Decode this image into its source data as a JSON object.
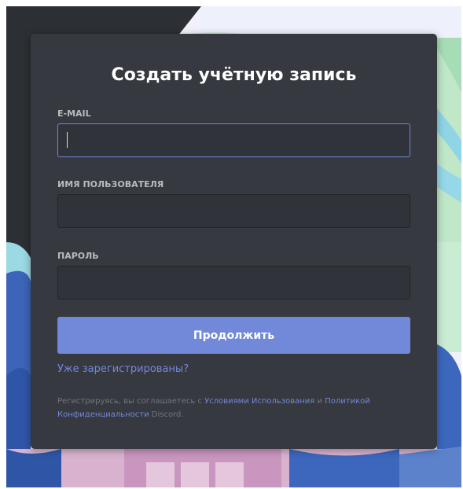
{
  "form": {
    "title": "Создать учётную запись",
    "email_label": "E-MAIL",
    "email_value": "",
    "username_label": "ИМЯ ПОЛЬЗОВАТЕЛЯ",
    "username_value": "",
    "password_label": "ПАРОЛЬ",
    "password_value": "",
    "submit_label": "Продолжить",
    "login_link": "Уже зарегистрированы?",
    "terms": {
      "prefix": "Регистрируясь, вы соглашаетесь с ",
      "terms_link": "Условиями Использования",
      "conjunction": " и ",
      "privacy_link": "Политикой Конфиденциальности",
      "suffix": " Discord."
    }
  },
  "colors": {
    "card_bg": "#36393f",
    "input_bg": "#303339",
    "accent": "#7289da",
    "label": "#b9bbbe",
    "muted": "#72767d"
  }
}
